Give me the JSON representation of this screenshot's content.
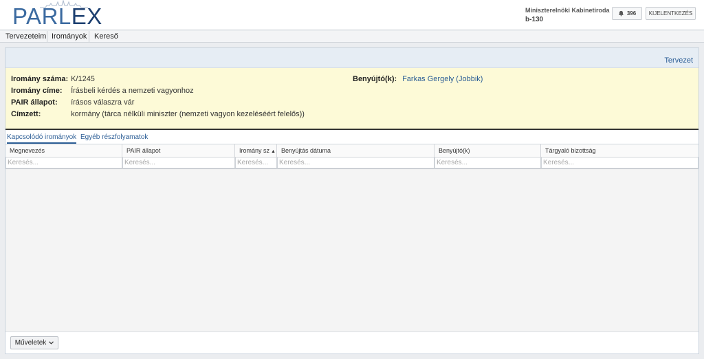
{
  "header": {
    "logo_text": "PARLEX",
    "organization": "Miniszterelnöki Kabinetiroda",
    "user_id": "b-130",
    "notification_count": "396",
    "logout_label": "KIJELENTKEZÉS"
  },
  "menu": {
    "items": [
      {
        "label": "Tervezeteim"
      },
      {
        "label": "Irományok"
      },
      {
        "label": "Kereső"
      }
    ]
  },
  "panel": {
    "top_link": "Tervezet",
    "fields": {
      "number_label": "Iromány száma:",
      "number_value": "K/1245",
      "title_label": "Iromány címe:",
      "title_value": "Írásbeli kérdés a nemzeti vagyonhoz",
      "pair_label": "PAIR állapot:",
      "pair_value": "írásos válaszra vár",
      "recipient_label": "Címzett:",
      "recipient_value": "kormány (tárca nélküli miniszter (nemzeti vagyon kezeléséért felelős))",
      "submitter_label": "Benyújtó(k):",
      "submitter_value": "Farkas Gergely (Jobbik)"
    }
  },
  "tabs": [
    {
      "label": "Kapcsolódó irományok",
      "active": true
    },
    {
      "label": "Egyéb részfolyamatok",
      "active": false
    }
  ],
  "grid": {
    "columns": [
      {
        "label": "Megnevezés"
      },
      {
        "label": "PAIR állapot"
      },
      {
        "label": "Iromány sz",
        "sort": "asc"
      },
      {
        "label": "Benyújtás dátuma"
      },
      {
        "label": "Benyújtó(k)"
      },
      {
        "label": "Tárgyaló bizottság"
      }
    ],
    "filter_placeholder": "Keresés..."
  },
  "footer": {
    "actions_label": "Műveletek"
  },
  "colors": {
    "brand": "#3b6aa0",
    "link": "#2b5d95",
    "info_background": "#fdfad7"
  }
}
